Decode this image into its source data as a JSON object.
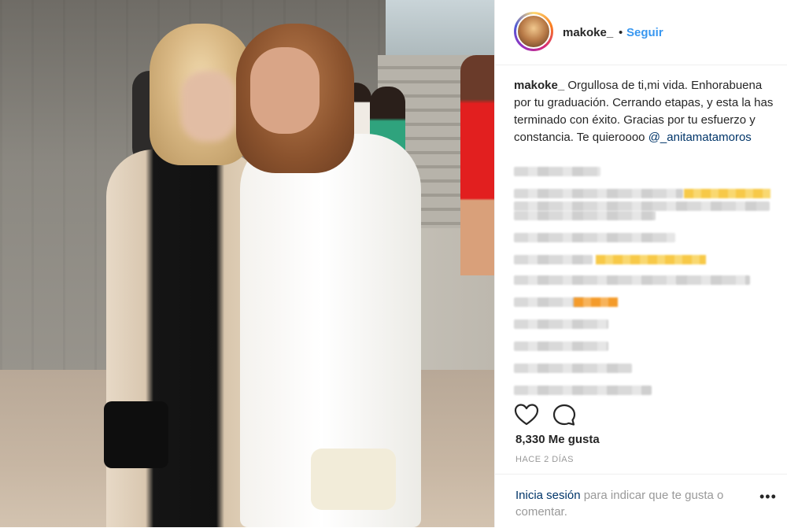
{
  "post": {
    "username": "makoke_",
    "dot": "•",
    "follow_label": "Seguir",
    "caption_user": "makoke_",
    "caption_text": " Orgullosa de ti,mi vida. Enhorabuena por tu graduación. Cerrando etapas, y esta la has terminado con éxito. Gracias por tu esfuerzo y constancia. Te quieroooo ",
    "caption_mention": "@_anitamatamoros",
    "likes": "8,330 Me gusta",
    "time": "HACE 2 DÍAS",
    "login_link": "Inicia sesión",
    "login_text": " para indicar que te gusta o comentar.",
    "more": "•••"
  },
  "icons": {
    "heart": "heart-icon",
    "comment": "comment-icon"
  },
  "colors": {
    "link_blue": "#3897f0",
    "mention_navy": "#003569",
    "muted_gray": "#999999"
  }
}
